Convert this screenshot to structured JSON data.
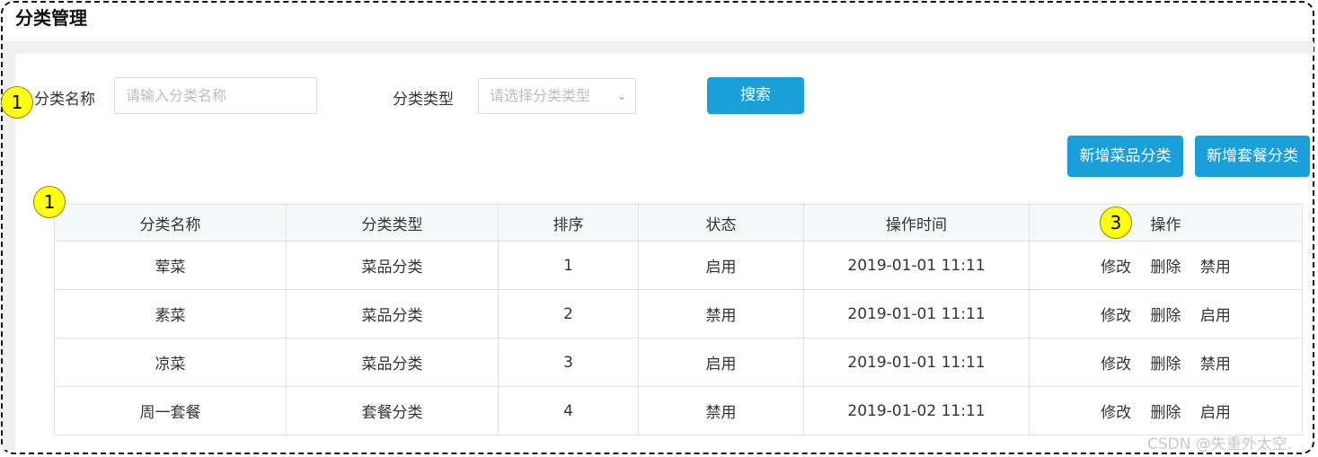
{
  "page": {
    "title": "分类管理"
  },
  "search": {
    "name_label": "分类名称",
    "name_placeholder": "请输入分类名称",
    "type_label": "分类类型",
    "type_placeholder": "请选择分类类型",
    "search_button": "搜索"
  },
  "actions": {
    "add_dish_category": "新增菜品分类",
    "add_combo_category": "新增套餐分类"
  },
  "badges": {
    "search_badge": "1",
    "table_badge": "1",
    "ops_badge": "3"
  },
  "table": {
    "columns": [
      "分类名称",
      "分类类型",
      "排序",
      "状态",
      "操作时间",
      "操作"
    ],
    "rows": [
      {
        "name": "荤菜",
        "type": "菜品分类",
        "sort": "1",
        "status": "启用",
        "time": "2019-01-01 11:11",
        "ops": [
          "修改",
          "删除",
          "禁用"
        ]
      },
      {
        "name": "素菜",
        "type": "菜品分类",
        "sort": "2",
        "status": "禁用",
        "time": "2019-01-01 11:11",
        "ops": [
          "修改",
          "删除",
          "启用"
        ]
      },
      {
        "name": "凉菜",
        "type": "菜品分类",
        "sort": "3",
        "status": "启用",
        "time": "2019-01-01 11:11",
        "ops": [
          "修改",
          "删除",
          "禁用"
        ]
      },
      {
        "name": "周一套餐",
        "type": "套餐分类",
        "sort": "4",
        "status": "禁用",
        "time": "2019-01-02 11:11",
        "ops": [
          "修改",
          "删除",
          "启用"
        ]
      }
    ]
  },
  "watermark": "CSDN @失重外太空.",
  "colors": {
    "primary": "#1a9fd8",
    "badge": "#ffff0f",
    "header_bg": "#f7f8fa"
  }
}
